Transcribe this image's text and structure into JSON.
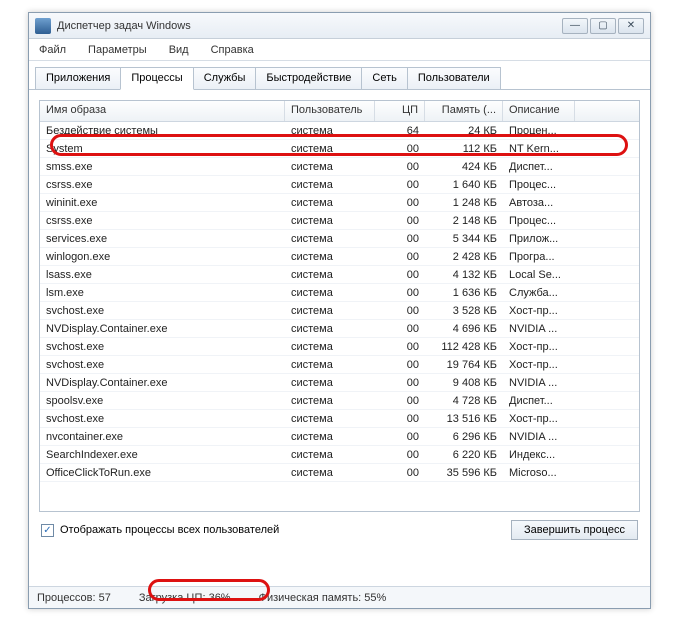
{
  "window": {
    "title": "Диспетчер задач Windows"
  },
  "menu": {
    "file": "Файл",
    "options": "Параметры",
    "view": "Вид",
    "help": "Справка"
  },
  "tabs": {
    "apps": "Приложения",
    "processes": "Процессы",
    "services": "Службы",
    "perf": "Быстродействие",
    "net": "Сеть",
    "users": "Пользователи"
  },
  "columns": {
    "image": "Имя образа",
    "user": "Пользователь",
    "cpu": "ЦП",
    "mem": "Память (...",
    "desc": "Описание"
  },
  "rows": [
    {
      "image": "Бездействие системы",
      "user": "система",
      "cpu": "64",
      "mem": "24 КБ",
      "desc": "Процен..."
    },
    {
      "image": "System",
      "user": "система",
      "cpu": "00",
      "mem": "112 КБ",
      "desc": "NT Kern..."
    },
    {
      "image": "smss.exe",
      "user": "система",
      "cpu": "00",
      "mem": "424 КБ",
      "desc": "Диспет..."
    },
    {
      "image": "csrss.exe",
      "user": "система",
      "cpu": "00",
      "mem": "1 640 КБ",
      "desc": "Процес..."
    },
    {
      "image": "wininit.exe",
      "user": "система",
      "cpu": "00",
      "mem": "1 248 КБ",
      "desc": "Автоза..."
    },
    {
      "image": "csrss.exe",
      "user": "система",
      "cpu": "00",
      "mem": "2 148 КБ",
      "desc": "Процес..."
    },
    {
      "image": "services.exe",
      "user": "система",
      "cpu": "00",
      "mem": "5 344 КБ",
      "desc": "Прилож..."
    },
    {
      "image": "winlogon.exe",
      "user": "система",
      "cpu": "00",
      "mem": "2 428 КБ",
      "desc": "Програ..."
    },
    {
      "image": "lsass.exe",
      "user": "система",
      "cpu": "00",
      "mem": "4 132 КБ",
      "desc": "Local Se..."
    },
    {
      "image": "lsm.exe",
      "user": "система",
      "cpu": "00",
      "mem": "1 636 КБ",
      "desc": "Служба..."
    },
    {
      "image": "svchost.exe",
      "user": "система",
      "cpu": "00",
      "mem": "3 528 КБ",
      "desc": "Хост-пр..."
    },
    {
      "image": "NVDisplay.Container.exe",
      "user": "система",
      "cpu": "00",
      "mem": "4 696 КБ",
      "desc": "NVIDIA ..."
    },
    {
      "image": "svchost.exe",
      "user": "система",
      "cpu": "00",
      "mem": "112 428 КБ",
      "desc": "Хост-пр..."
    },
    {
      "image": "svchost.exe",
      "user": "система",
      "cpu": "00",
      "mem": "19 764 КБ",
      "desc": "Хост-пр..."
    },
    {
      "image": "NVDisplay.Container.exe",
      "user": "система",
      "cpu": "00",
      "mem": "9 408 КБ",
      "desc": "NVIDIA ..."
    },
    {
      "image": "spoolsv.exe",
      "user": "система",
      "cpu": "00",
      "mem": "4 728 КБ",
      "desc": "Диспет..."
    },
    {
      "image": "svchost.exe",
      "user": "система",
      "cpu": "00",
      "mem": "13 516 КБ",
      "desc": "Хост-пр..."
    },
    {
      "image": "nvcontainer.exe",
      "user": "система",
      "cpu": "00",
      "mem": "6 296 КБ",
      "desc": "NVIDIA ..."
    },
    {
      "image": "SearchIndexer.exe",
      "user": "система",
      "cpu": "00",
      "mem": "6 220 КБ",
      "desc": "Индекс..."
    },
    {
      "image": "OfficeClickToRun.exe",
      "user": "система",
      "cpu": "00",
      "mem": "35 596 КБ",
      "desc": "Microso..."
    }
  ],
  "checkbox_label": "Отображать процессы всех пользователей",
  "end_button": "Завершить процесс",
  "status": {
    "procs": "Процессов: 57",
    "cpu": "Загрузка ЦП: 36%",
    "mem": "Физическая память: 55%"
  }
}
